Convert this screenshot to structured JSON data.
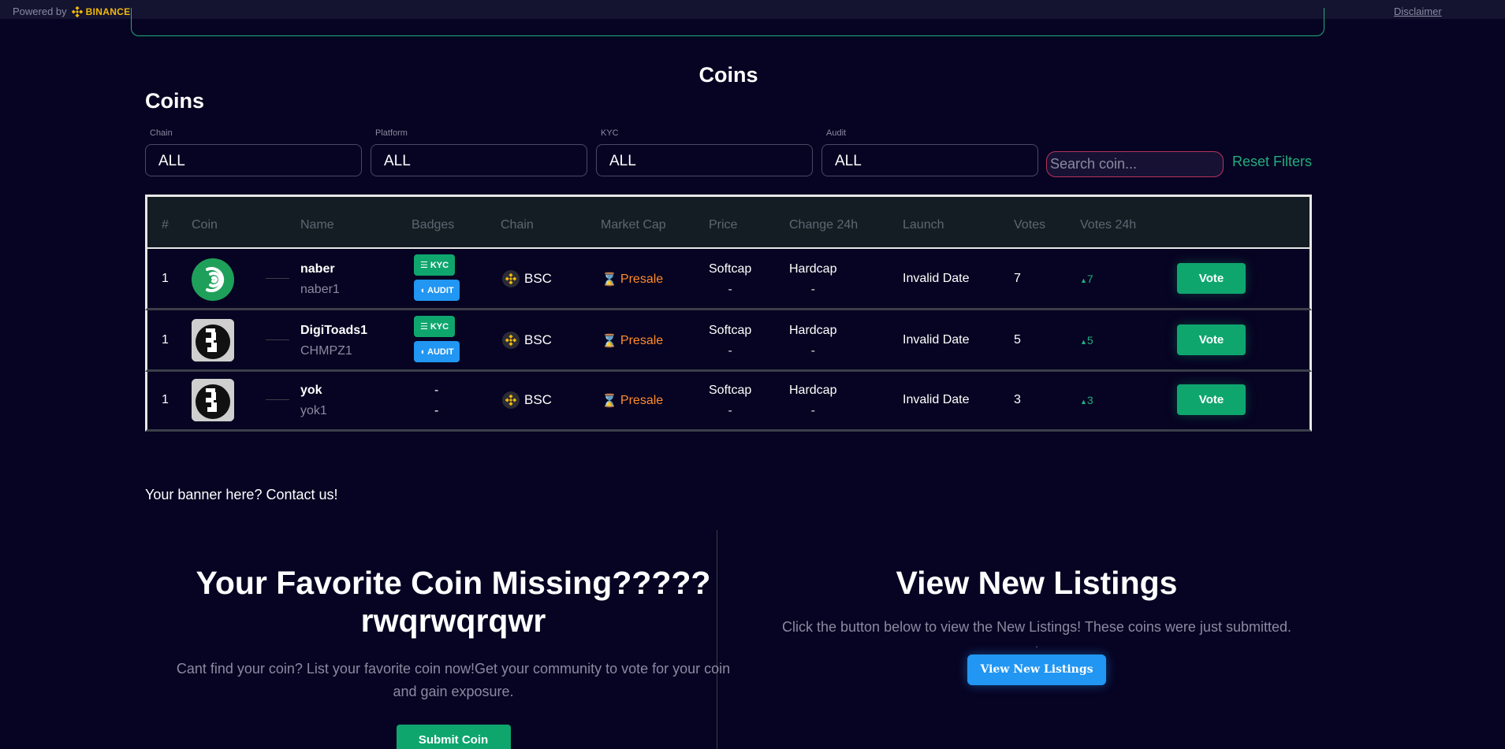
{
  "topbar": {
    "powered_label": "Powered by",
    "brand": "BINANCE",
    "disclaimer": "Disclaimer"
  },
  "headings": {
    "center_title": "Coins",
    "section_title": "Coins"
  },
  "filters": [
    {
      "label": "Chain",
      "value": "ALL"
    },
    {
      "label": "Platform",
      "value": "ALL"
    },
    {
      "label": "KYC",
      "value": "ALL"
    },
    {
      "label": "Audit",
      "value": "ALL"
    }
  ],
  "search": {
    "placeholder": "Search coin..."
  },
  "reset_label": "Reset Filters",
  "table": {
    "headers": [
      "#",
      "Coin",
      "Name",
      "Badges",
      "Chain",
      "Market Cap",
      "Price",
      "Change 24h",
      "Launch",
      "Votes",
      "Votes 24h"
    ],
    "rows": [
      {
        "rank": "1",
        "name": "naber",
        "symbol": "naber1",
        "kyc": "KYC",
        "audit": "AUDIT",
        "chain": "BSC",
        "market_cap": "Presale",
        "price_label": "Softcap",
        "price_value": "-",
        "change_label": "Hardcap",
        "change_value": "-",
        "launch": "Invalid Date",
        "votes": "7",
        "votes_24h": "7",
        "vote_label": "Vote"
      },
      {
        "rank": "1",
        "name": "DigiToads1",
        "symbol": "CHMPZ1",
        "kyc": "KYC",
        "audit": "AUDIT",
        "chain": "BSC",
        "market_cap": "Presale",
        "price_label": "Softcap",
        "price_value": "-",
        "change_label": "Hardcap",
        "change_value": "-",
        "launch": "Invalid Date",
        "votes": "5",
        "votes_24h": "5",
        "vote_label": "Vote"
      },
      {
        "rank": "1",
        "name": "yok",
        "symbol": "yok1",
        "badge_line1": "-",
        "badge_line2": "-",
        "chain": "BSC",
        "market_cap": "Presale",
        "price_label": "Softcap",
        "price_value": "-",
        "change_label": "Hardcap",
        "change_value": "-",
        "launch": "Invalid Date",
        "votes": "3",
        "votes_24h": "3",
        "vote_label": "Vote"
      }
    ]
  },
  "banner_text": "Your banner here? Contact us!",
  "left_cta": {
    "title_line1": "Your Favorite Coin Missing?????",
    "title_line2": "rwqrwqrqwr",
    "text": "Cant find your coin? List your favorite coin now!Get your community to vote for your coin and gain exposure.",
    "button": "Submit Coin"
  },
  "right_cta": {
    "title": "View New Listings",
    "text": "Click the button below to view the New Listings! These coins were just submitted.",
    "dot": ".",
    "button": "View New Listings"
  },
  "colors": {
    "accent_green": "#0fa66e",
    "accent_blue": "#2196f3",
    "presale_orange": "#ff8c2a",
    "background": "#070322",
    "binance_yellow": "#f0b90b"
  }
}
